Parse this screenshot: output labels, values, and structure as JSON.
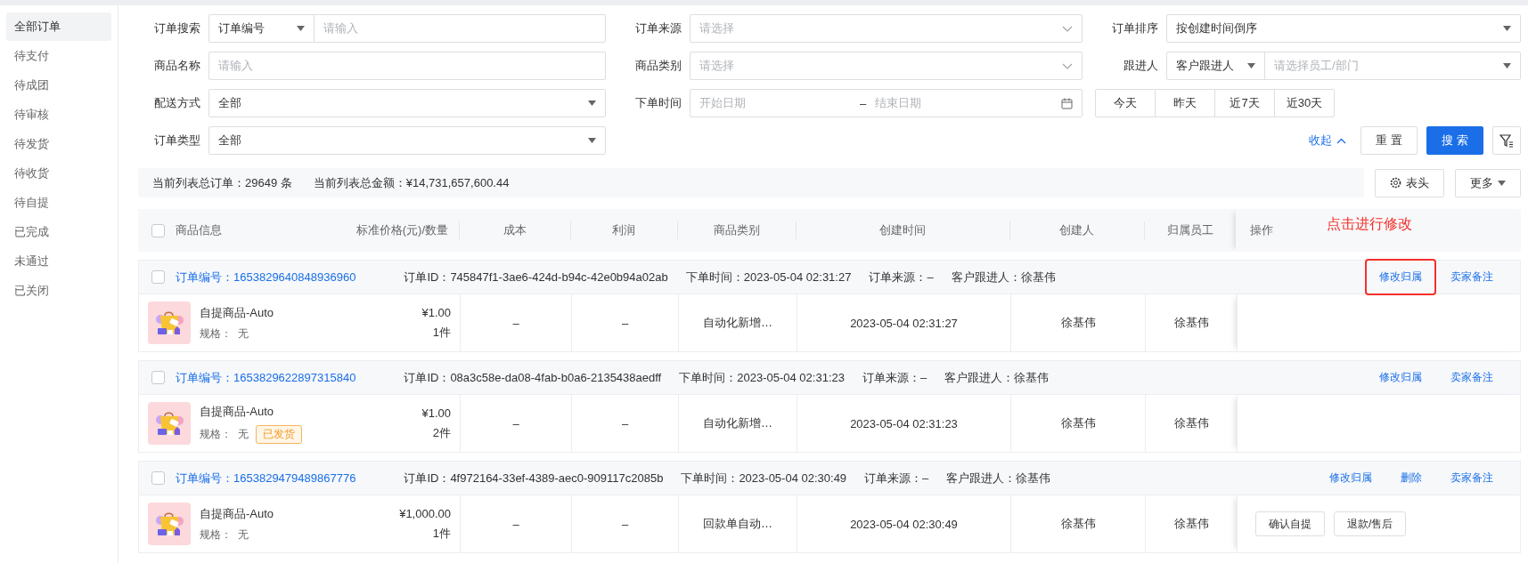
{
  "sidebar": {
    "items": [
      {
        "label": "全部订单",
        "selected": true
      },
      {
        "label": "待支付",
        "selected": false
      },
      {
        "label": "待成团",
        "selected": false
      },
      {
        "label": "待审核",
        "selected": false
      },
      {
        "label": "待发货",
        "selected": false
      },
      {
        "label": "待收货",
        "selected": false
      },
      {
        "label": "待自提",
        "selected": false
      },
      {
        "label": "已完成",
        "selected": false
      },
      {
        "label": "未通过",
        "selected": false
      },
      {
        "label": "已关闭",
        "selected": false
      }
    ]
  },
  "filters": [
    {
      "kind": "select-input",
      "label": "订单搜索",
      "select": "订单编号",
      "placeholder": "请输入"
    },
    {
      "kind": "picker",
      "label": "订单来源",
      "placeholder": "请选择"
    },
    {
      "kind": "select",
      "label": "订单排序",
      "value": "按创建时间倒序"
    },
    {
      "kind": "input",
      "label": "商品名称",
      "placeholder": "请输入"
    },
    {
      "kind": "picker",
      "label": "商品类别",
      "placeholder": "请选择"
    },
    {
      "kind": "select-select",
      "label": "跟进人",
      "select": "客户跟进人",
      "placeholder": "请选择员工/部门"
    },
    {
      "kind": "select",
      "label": "配送方式",
      "value": "全部"
    },
    {
      "kind": "date-range",
      "label": "下单时间",
      "start_placeholder": "开始日期",
      "separator": "–",
      "end_placeholder": "结束日期"
    },
    {
      "kind": "quick-dates",
      "options": [
        "今天",
        "昨天",
        "近7天",
        "近30天"
      ]
    },
    {
      "kind": "select",
      "label": "订单类型",
      "value": "全部"
    }
  ],
  "filter_actions": {
    "collapse": "收起",
    "reset": "重 置",
    "search": "搜 索"
  },
  "summary": {
    "texts": [
      "当前列表总订单：29649 条",
      "当前列表总金额：¥14,731,657,600.44"
    ],
    "columns_button": "表头",
    "more_button": "更多"
  },
  "table": {
    "select_all_checked": false,
    "columns": [
      "商品信息",
      "标准价格(元)/数量",
      "成本",
      "利润",
      "商品类别",
      "创建时间",
      "创建人",
      "归属员工",
      "操作"
    ],
    "annotation": "点击进行修改",
    "orders": [
      {
        "checked": false,
        "order_no": "订单编号：1653829640848936960",
        "meta": [
          "订单ID：745847f1-3ae6-424d-b94c-42e0b94a02ab",
          "下单时间：2023-05-04 02:31:27",
          "订单来源：–",
          "客户跟进人：徐基伟"
        ],
        "actions": [
          {
            "label": "修改归属",
            "highlighted": true
          },
          {
            "label": "卖家备注",
            "highlighted": false
          }
        ],
        "product": {
          "name": "自提商品-Auto",
          "spec": "规格：  无",
          "price": "¥1.00",
          "qty": "1件"
        },
        "cells": [
          "–",
          "–",
          "自动化新增…",
          "2023-05-04 02:31:27",
          "徐基伟",
          "徐基伟"
        ]
      },
      {
        "checked": false,
        "order_no": "订单编号：1653829622897315840",
        "meta": [
          "订单ID：08a3c58e-da08-4fab-b0a6-2135438aedff",
          "下单时间：2023-05-04 02:31:23",
          "订单来源：–",
          "客户跟进人：徐基伟"
        ],
        "actions": [
          {
            "label": "修改归属",
            "highlighted": false
          },
          {
            "label": "卖家备注",
            "highlighted": false
          }
        ],
        "product": {
          "name": "自提商品-Auto",
          "spec": "规格：  无",
          "tag": "已发货",
          "price": "¥1.00",
          "qty": "2件"
        },
        "cells": [
          "–",
          "–",
          "自动化新增…",
          "2023-05-04 02:31:23",
          "徐基伟",
          "徐基伟"
        ]
      },
      {
        "checked": false,
        "order_no": "订单编号：1653829479489867776",
        "meta": [
          "订单ID：4f972164-33ef-4389-aec0-909117c2085b",
          "下单时间：2023-05-04 02:30:49",
          "订单来源：–",
          "客户跟进人：徐基伟"
        ],
        "actions": [
          {
            "label": "修改归属",
            "highlighted": false
          },
          {
            "label": "删除",
            "highlighted": false
          },
          {
            "label": "卖家备注",
            "highlighted": false
          }
        ],
        "product": {
          "name": "自提商品-Auto",
          "spec": "规格：  无",
          "price": "¥1,000.00",
          "qty": "1件"
        },
        "cells": [
          "–",
          "–",
          "回款单自动…",
          "2023-05-04 02:30:49",
          "徐基伟",
          "徐基伟"
        ],
        "buttons": [
          "确认自提",
          "退款/售后"
        ]
      }
    ]
  }
}
